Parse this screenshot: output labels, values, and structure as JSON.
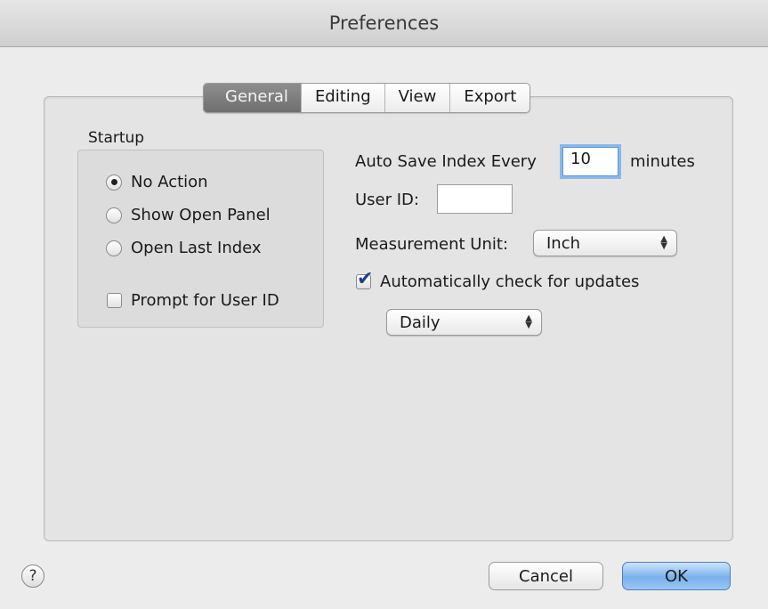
{
  "window": {
    "title": "Preferences"
  },
  "tabs": [
    {
      "label": "General",
      "active": true
    },
    {
      "label": "Editing",
      "active": false
    },
    {
      "label": "View",
      "active": false
    },
    {
      "label": "Export",
      "active": false
    }
  ],
  "startup": {
    "label": "Startup",
    "options": [
      {
        "label": "No Action",
        "selected": true
      },
      {
        "label": "Show Open Panel",
        "selected": false
      },
      {
        "label": "Open Last Index",
        "selected": false
      }
    ],
    "prompt_user_id": {
      "label": "Prompt for User ID",
      "checked": false
    }
  },
  "autosave": {
    "label": "Auto Save Index Every",
    "value": "10",
    "unit": "minutes"
  },
  "user_id": {
    "label": "User ID:",
    "value": ""
  },
  "measurement": {
    "label": "Measurement Unit:",
    "value": "Inch"
  },
  "updates": {
    "label": "Automatically check for updates",
    "checked": true,
    "frequency": "Daily"
  },
  "buttons": {
    "cancel": "Cancel",
    "ok": "OK",
    "help": "?"
  },
  "colors": {
    "accent": "#79b1ec",
    "focus_ring": "#8bb8ec",
    "active_tab": "#7a7a7a"
  }
}
